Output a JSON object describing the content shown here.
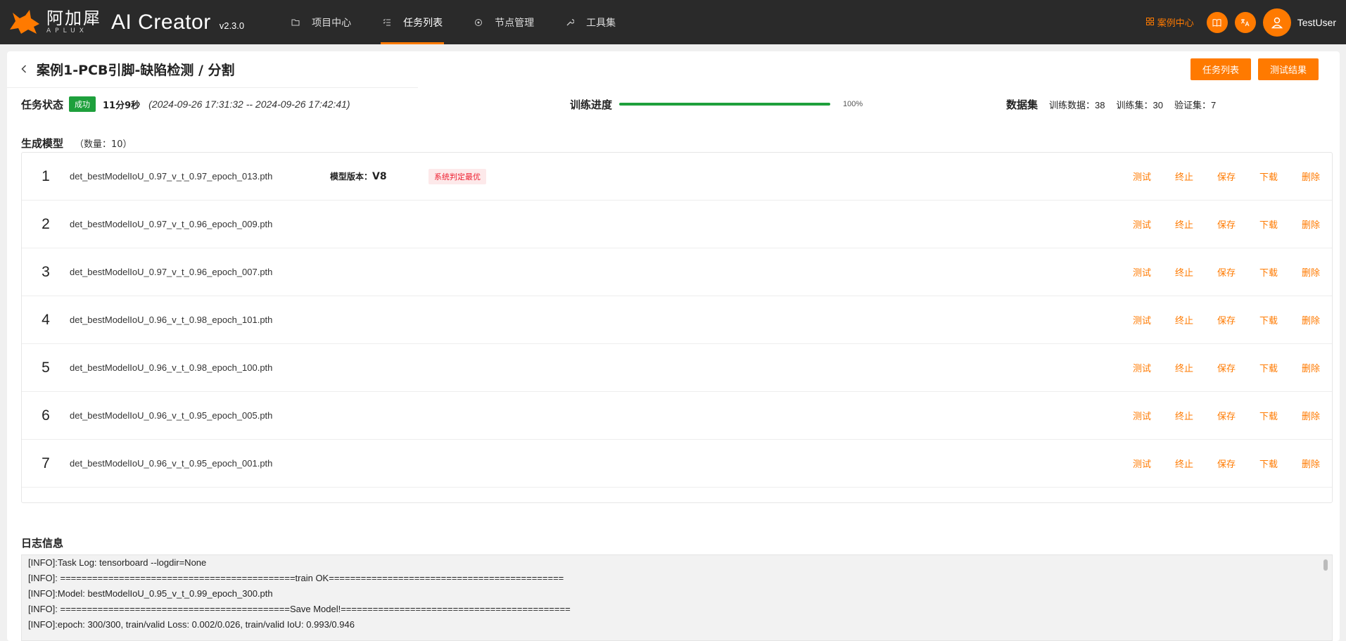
{
  "brand": {
    "logo_cn": "阿加犀",
    "logo_en": "APLUX",
    "app_name": "AI Creator",
    "version": "v2.3.0"
  },
  "nav": [
    {
      "label": "项目中心",
      "icon": "folder-icon",
      "active": false
    },
    {
      "label": "任务列表",
      "icon": "list-check-icon",
      "active": true
    },
    {
      "label": "节点管理",
      "icon": "node-icon",
      "active": false
    },
    {
      "label": "工具集",
      "icon": "wrench-icon",
      "active": false
    }
  ],
  "topbar": {
    "case_center": "案例中心",
    "username": "TestUser"
  },
  "page": {
    "title": "案例1-PCB引脚-缺陷检测 / 分割",
    "btn_task_list": "任务列表",
    "btn_test_results": "测试结果"
  },
  "status": {
    "label": "任务状态",
    "badge": "成功",
    "duration": "11分9秒",
    "time_range": "(2024-09-26 17:31:32 -- 2024-09-26 17:42:41)",
    "progress_label": "训练进度",
    "progress_value": 100,
    "progress_text": "100%",
    "dataset_label": "数据集",
    "train_data": "训练数据：38",
    "train_set": "训练集：30",
    "val_set": "验证集：7"
  },
  "models": {
    "title": "生成模型",
    "count": "（数量：10）",
    "version_label": "模型版本：",
    "version_value": "V8",
    "best_badge": "系统判定最优",
    "actions": [
      "测试",
      "终止",
      "保存",
      "下载",
      "删除"
    ],
    "items": [
      {
        "index": "1",
        "file": "det_bestModelIoU_0.97_v_t_0.97_epoch_013.pth"
      },
      {
        "index": "2",
        "file": "det_bestModelIoU_0.97_v_t_0.96_epoch_009.pth"
      },
      {
        "index": "3",
        "file": "det_bestModelIoU_0.97_v_t_0.96_epoch_007.pth"
      },
      {
        "index": "4",
        "file": "det_bestModelIoU_0.96_v_t_0.98_epoch_101.pth"
      },
      {
        "index": "5",
        "file": "det_bestModelIoU_0.96_v_t_0.98_epoch_100.pth"
      },
      {
        "index": "6",
        "file": "det_bestModelIoU_0.96_v_t_0.95_epoch_005.pth"
      },
      {
        "index": "7",
        "file": "det_bestModelIoU_0.96_v_t_0.95_epoch_001.pth"
      }
    ]
  },
  "log": {
    "title": "日志信息",
    "lines": [
      "[INFO]:Task Log: tensorboard --logdir=None",
      "[INFO]: ============================================train OK============================================",
      "[INFO]:Model: bestModelIoU_0.95_v_t_0.99_epoch_300.pth",
      "[INFO]: ===========================================Save Model!===========================================",
      "[INFO]:epoch: 300/300, train/valid Loss: 0.002/0.026, train/valid IoU: 0.993/0.946"
    ]
  },
  "colors": {
    "accent": "#ff7a00",
    "success": "#1ea03c",
    "danger": "#e23333",
    "topbar": "#2a2a2a"
  }
}
